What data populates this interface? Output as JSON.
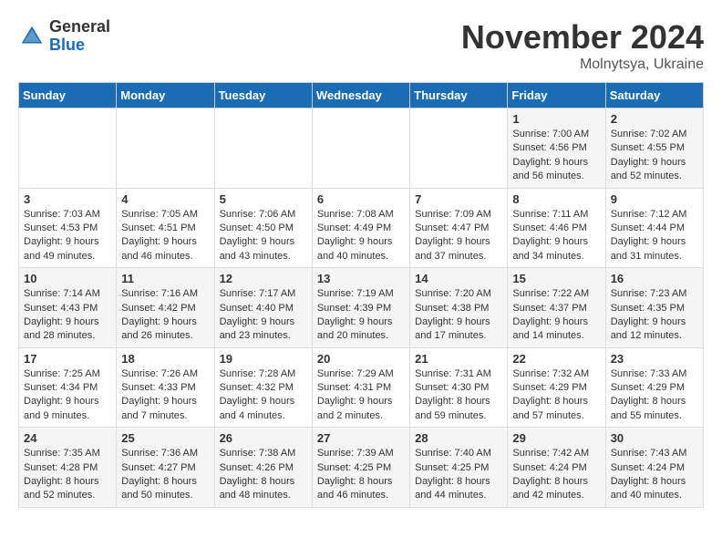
{
  "app": {
    "logo_general": "General",
    "logo_blue": "Blue"
  },
  "title": {
    "month_year": "November 2024",
    "location": "Molnytsya, Ukraine"
  },
  "calendar": {
    "headers": [
      "Sunday",
      "Monday",
      "Tuesday",
      "Wednesday",
      "Thursday",
      "Friday",
      "Saturday"
    ],
    "weeks": [
      [
        {
          "day": "",
          "info": ""
        },
        {
          "day": "",
          "info": ""
        },
        {
          "day": "",
          "info": ""
        },
        {
          "day": "",
          "info": ""
        },
        {
          "day": "",
          "info": ""
        },
        {
          "day": "1",
          "info": "Sunrise: 7:00 AM\nSunset: 4:56 PM\nDaylight: 9 hours and 56 minutes."
        },
        {
          "day": "2",
          "info": "Sunrise: 7:02 AM\nSunset: 4:55 PM\nDaylight: 9 hours and 52 minutes."
        }
      ],
      [
        {
          "day": "3",
          "info": "Sunrise: 7:03 AM\nSunset: 4:53 PM\nDaylight: 9 hours and 49 minutes."
        },
        {
          "day": "4",
          "info": "Sunrise: 7:05 AM\nSunset: 4:51 PM\nDaylight: 9 hours and 46 minutes."
        },
        {
          "day": "5",
          "info": "Sunrise: 7:06 AM\nSunset: 4:50 PM\nDaylight: 9 hours and 43 minutes."
        },
        {
          "day": "6",
          "info": "Sunrise: 7:08 AM\nSunset: 4:49 PM\nDaylight: 9 hours and 40 minutes."
        },
        {
          "day": "7",
          "info": "Sunrise: 7:09 AM\nSunset: 4:47 PM\nDaylight: 9 hours and 37 minutes."
        },
        {
          "day": "8",
          "info": "Sunrise: 7:11 AM\nSunset: 4:46 PM\nDaylight: 9 hours and 34 minutes."
        },
        {
          "day": "9",
          "info": "Sunrise: 7:12 AM\nSunset: 4:44 PM\nDaylight: 9 hours and 31 minutes."
        }
      ],
      [
        {
          "day": "10",
          "info": "Sunrise: 7:14 AM\nSunset: 4:43 PM\nDaylight: 9 hours and 28 minutes."
        },
        {
          "day": "11",
          "info": "Sunrise: 7:16 AM\nSunset: 4:42 PM\nDaylight: 9 hours and 26 minutes."
        },
        {
          "day": "12",
          "info": "Sunrise: 7:17 AM\nSunset: 4:40 PM\nDaylight: 9 hours and 23 minutes."
        },
        {
          "day": "13",
          "info": "Sunrise: 7:19 AM\nSunset: 4:39 PM\nDaylight: 9 hours and 20 minutes."
        },
        {
          "day": "14",
          "info": "Sunrise: 7:20 AM\nSunset: 4:38 PM\nDaylight: 9 hours and 17 minutes."
        },
        {
          "day": "15",
          "info": "Sunrise: 7:22 AM\nSunset: 4:37 PM\nDaylight: 9 hours and 14 minutes."
        },
        {
          "day": "16",
          "info": "Sunrise: 7:23 AM\nSunset: 4:35 PM\nDaylight: 9 hours and 12 minutes."
        }
      ],
      [
        {
          "day": "17",
          "info": "Sunrise: 7:25 AM\nSunset: 4:34 PM\nDaylight: 9 hours and 9 minutes."
        },
        {
          "day": "18",
          "info": "Sunrise: 7:26 AM\nSunset: 4:33 PM\nDaylight: 9 hours and 7 minutes."
        },
        {
          "day": "19",
          "info": "Sunrise: 7:28 AM\nSunset: 4:32 PM\nDaylight: 9 hours and 4 minutes."
        },
        {
          "day": "20",
          "info": "Sunrise: 7:29 AM\nSunset: 4:31 PM\nDaylight: 9 hours and 2 minutes."
        },
        {
          "day": "21",
          "info": "Sunrise: 7:31 AM\nSunset: 4:30 PM\nDaylight: 8 hours and 59 minutes."
        },
        {
          "day": "22",
          "info": "Sunrise: 7:32 AM\nSunset: 4:29 PM\nDaylight: 8 hours and 57 minutes."
        },
        {
          "day": "23",
          "info": "Sunrise: 7:33 AM\nSunset: 4:29 PM\nDaylight: 8 hours and 55 minutes."
        }
      ],
      [
        {
          "day": "24",
          "info": "Sunrise: 7:35 AM\nSunset: 4:28 PM\nDaylight: 8 hours and 52 minutes."
        },
        {
          "day": "25",
          "info": "Sunrise: 7:36 AM\nSunset: 4:27 PM\nDaylight: 8 hours and 50 minutes."
        },
        {
          "day": "26",
          "info": "Sunrise: 7:38 AM\nSunset: 4:26 PM\nDaylight: 8 hours and 48 minutes."
        },
        {
          "day": "27",
          "info": "Sunrise: 7:39 AM\nSunset: 4:25 PM\nDaylight: 8 hours and 46 minutes."
        },
        {
          "day": "28",
          "info": "Sunrise: 7:40 AM\nSunset: 4:25 PM\nDaylight: 8 hours and 44 minutes."
        },
        {
          "day": "29",
          "info": "Sunrise: 7:42 AM\nSunset: 4:24 PM\nDaylight: 8 hours and 42 minutes."
        },
        {
          "day": "30",
          "info": "Sunrise: 7:43 AM\nSunset: 4:24 PM\nDaylight: 8 hours and 40 minutes."
        }
      ]
    ]
  }
}
